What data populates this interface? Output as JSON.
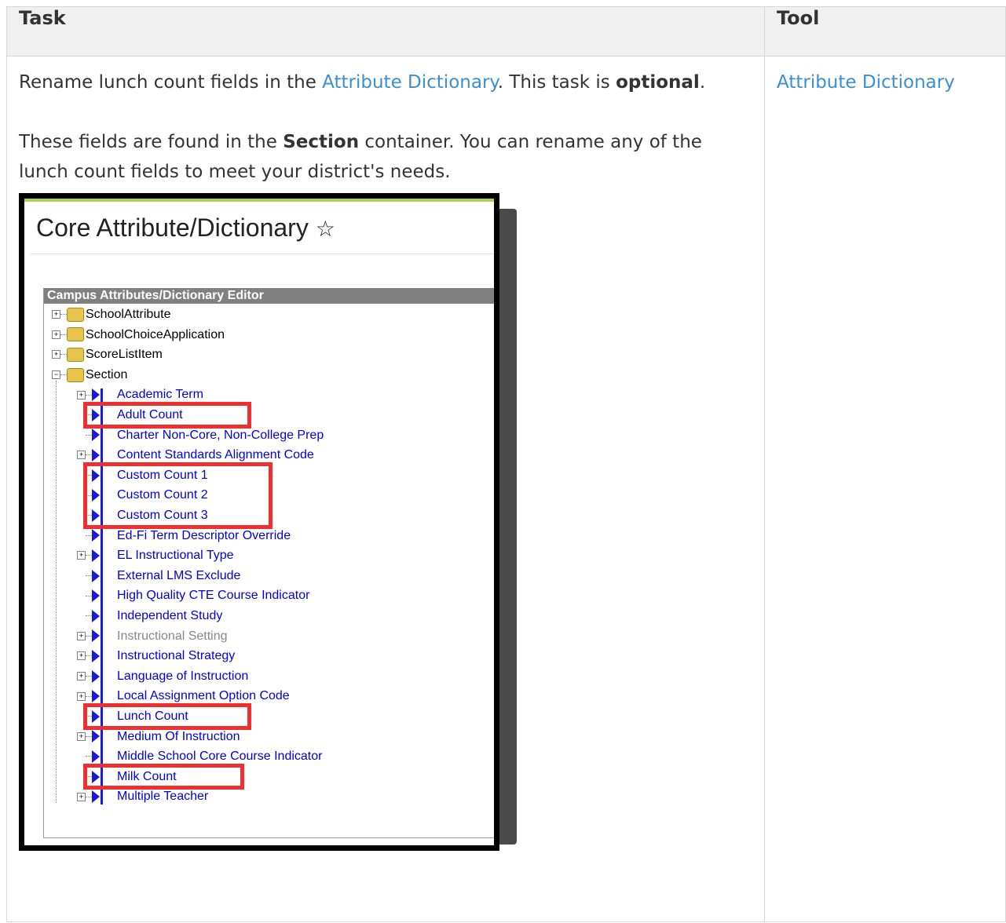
{
  "table": {
    "header_task": "Task",
    "header_tool": "Tool"
  },
  "task": {
    "p1_prefix": "Rename lunch count fields in the ",
    "p1_link": "Attribute Dictionary",
    "p1_suffix": ". This task is ",
    "p1_bold": "optional",
    "p1_end": ".",
    "p2_prefix": "These fields are found in the ",
    "p2_bold": "Section",
    "p2_suffix": " container. You can rename any of the lunch count fields to meet your district's needs."
  },
  "tool": {
    "link": "Attribute Dictionary"
  },
  "screenshot": {
    "title": "Core Attribute/Dictionary",
    "star_icon": "☆",
    "editor_title": "Campus Attributes/Dictionary Editor",
    "folders": [
      "SchoolAttribute",
      "SchoolChoiceApplication",
      "ScoreListItem",
      "Section"
    ],
    "items": [
      "Academic Term",
      "Adult Count",
      "Charter Non-Core, Non-College Prep",
      "Content Standards Alignment Code",
      "Custom Count 1",
      "Custom Count 2",
      "Custom Count 3",
      "Ed-Fi Term Descriptor Override",
      "EL Instructional Type",
      "External LMS Exclude",
      "High Quality CTE Course Indicator",
      "Independent Study",
      "Instructional Setting",
      "Instructional Strategy",
      "Language of Instruction",
      "Local Assignment Option Code",
      "Lunch Count",
      "Medium Of Instruction",
      "Middle School Core Course Indicator",
      "Milk Count",
      "Multiple Teacher"
    ],
    "highlight_color": "#ee3030",
    "link_color": "#0000dd"
  }
}
